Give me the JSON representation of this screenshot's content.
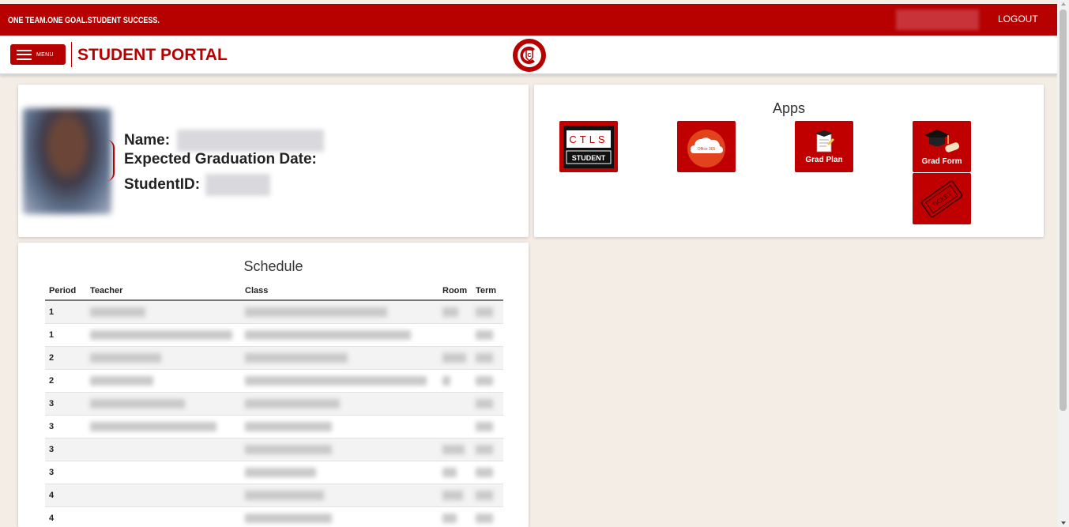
{
  "header": {
    "tagline": "ONE TEAM.ONE GOAL.STUDENT SUCCESS.",
    "logout_label": "LOGOUT"
  },
  "nav": {
    "menu_label": "MENU",
    "portal_title": "STUDENT PORTAL"
  },
  "profile": {
    "name_label": "Name:",
    "grad_date_label": "Expected Graduation Date:",
    "student_id_label": "StudentID:"
  },
  "apps": {
    "title": "Apps",
    "items": [
      {
        "name": "ctls-student",
        "label": "",
        "icon_text_top": "CTLS",
        "icon_text_bottom": "STUDENT"
      },
      {
        "name": "office-365",
        "label": "",
        "icon_text": "Office 365"
      },
      {
        "name": "grad-plan",
        "label": "Grad Plan"
      },
      {
        "name": "grad-form",
        "label": "Grad Form"
      },
      {
        "name": "ticket",
        "label": "",
        "icon_text": "TICKET"
      }
    ]
  },
  "schedule": {
    "title": "Schedule",
    "columns": [
      "Period",
      "Teacher",
      "Class",
      "Room",
      "Term"
    ],
    "rows": [
      {
        "period": "1"
      },
      {
        "period": "1"
      },
      {
        "period": "2"
      },
      {
        "period": "2"
      },
      {
        "period": "3"
      },
      {
        "period": "3"
      },
      {
        "period": "3"
      },
      {
        "period": "3"
      },
      {
        "period": "4"
      },
      {
        "period": "4"
      }
    ]
  },
  "colors": {
    "brand_red": "#b70000",
    "background": "#f4ede6"
  }
}
